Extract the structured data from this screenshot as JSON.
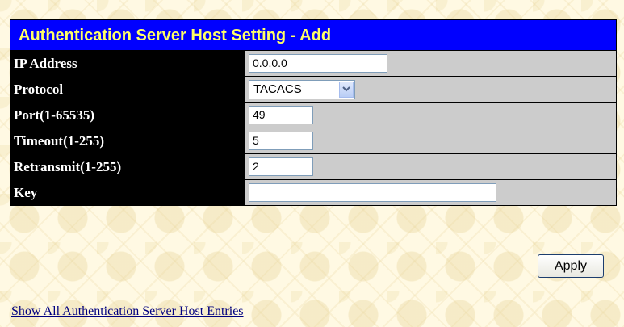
{
  "panel": {
    "title": "Authentication Server Host Setting - Add"
  },
  "fields": {
    "ip_address": {
      "label": "IP Address",
      "value": "0.0.0.0"
    },
    "protocol": {
      "label": "Protocol",
      "value": "TACACS"
    },
    "port": {
      "label": "Port(1-65535)",
      "value": "49"
    },
    "timeout": {
      "label": "Timeout(1-255)",
      "value": "5"
    },
    "retransmit": {
      "label": "Retransmit(1-255)",
      "value": "2"
    },
    "key": {
      "label": "Key",
      "value": ""
    }
  },
  "buttons": {
    "apply_label": "Apply"
  },
  "links": {
    "show_all_label": "Show All Authentication Server Host Entries"
  },
  "colors": {
    "title_background": "#0000ff",
    "title_text": "#ffff66",
    "label_background": "#000000",
    "value_background": "#cccccc",
    "page_background": "#fff9e3"
  },
  "icons": {
    "protocol_dropdown": "chevron-down-icon"
  }
}
